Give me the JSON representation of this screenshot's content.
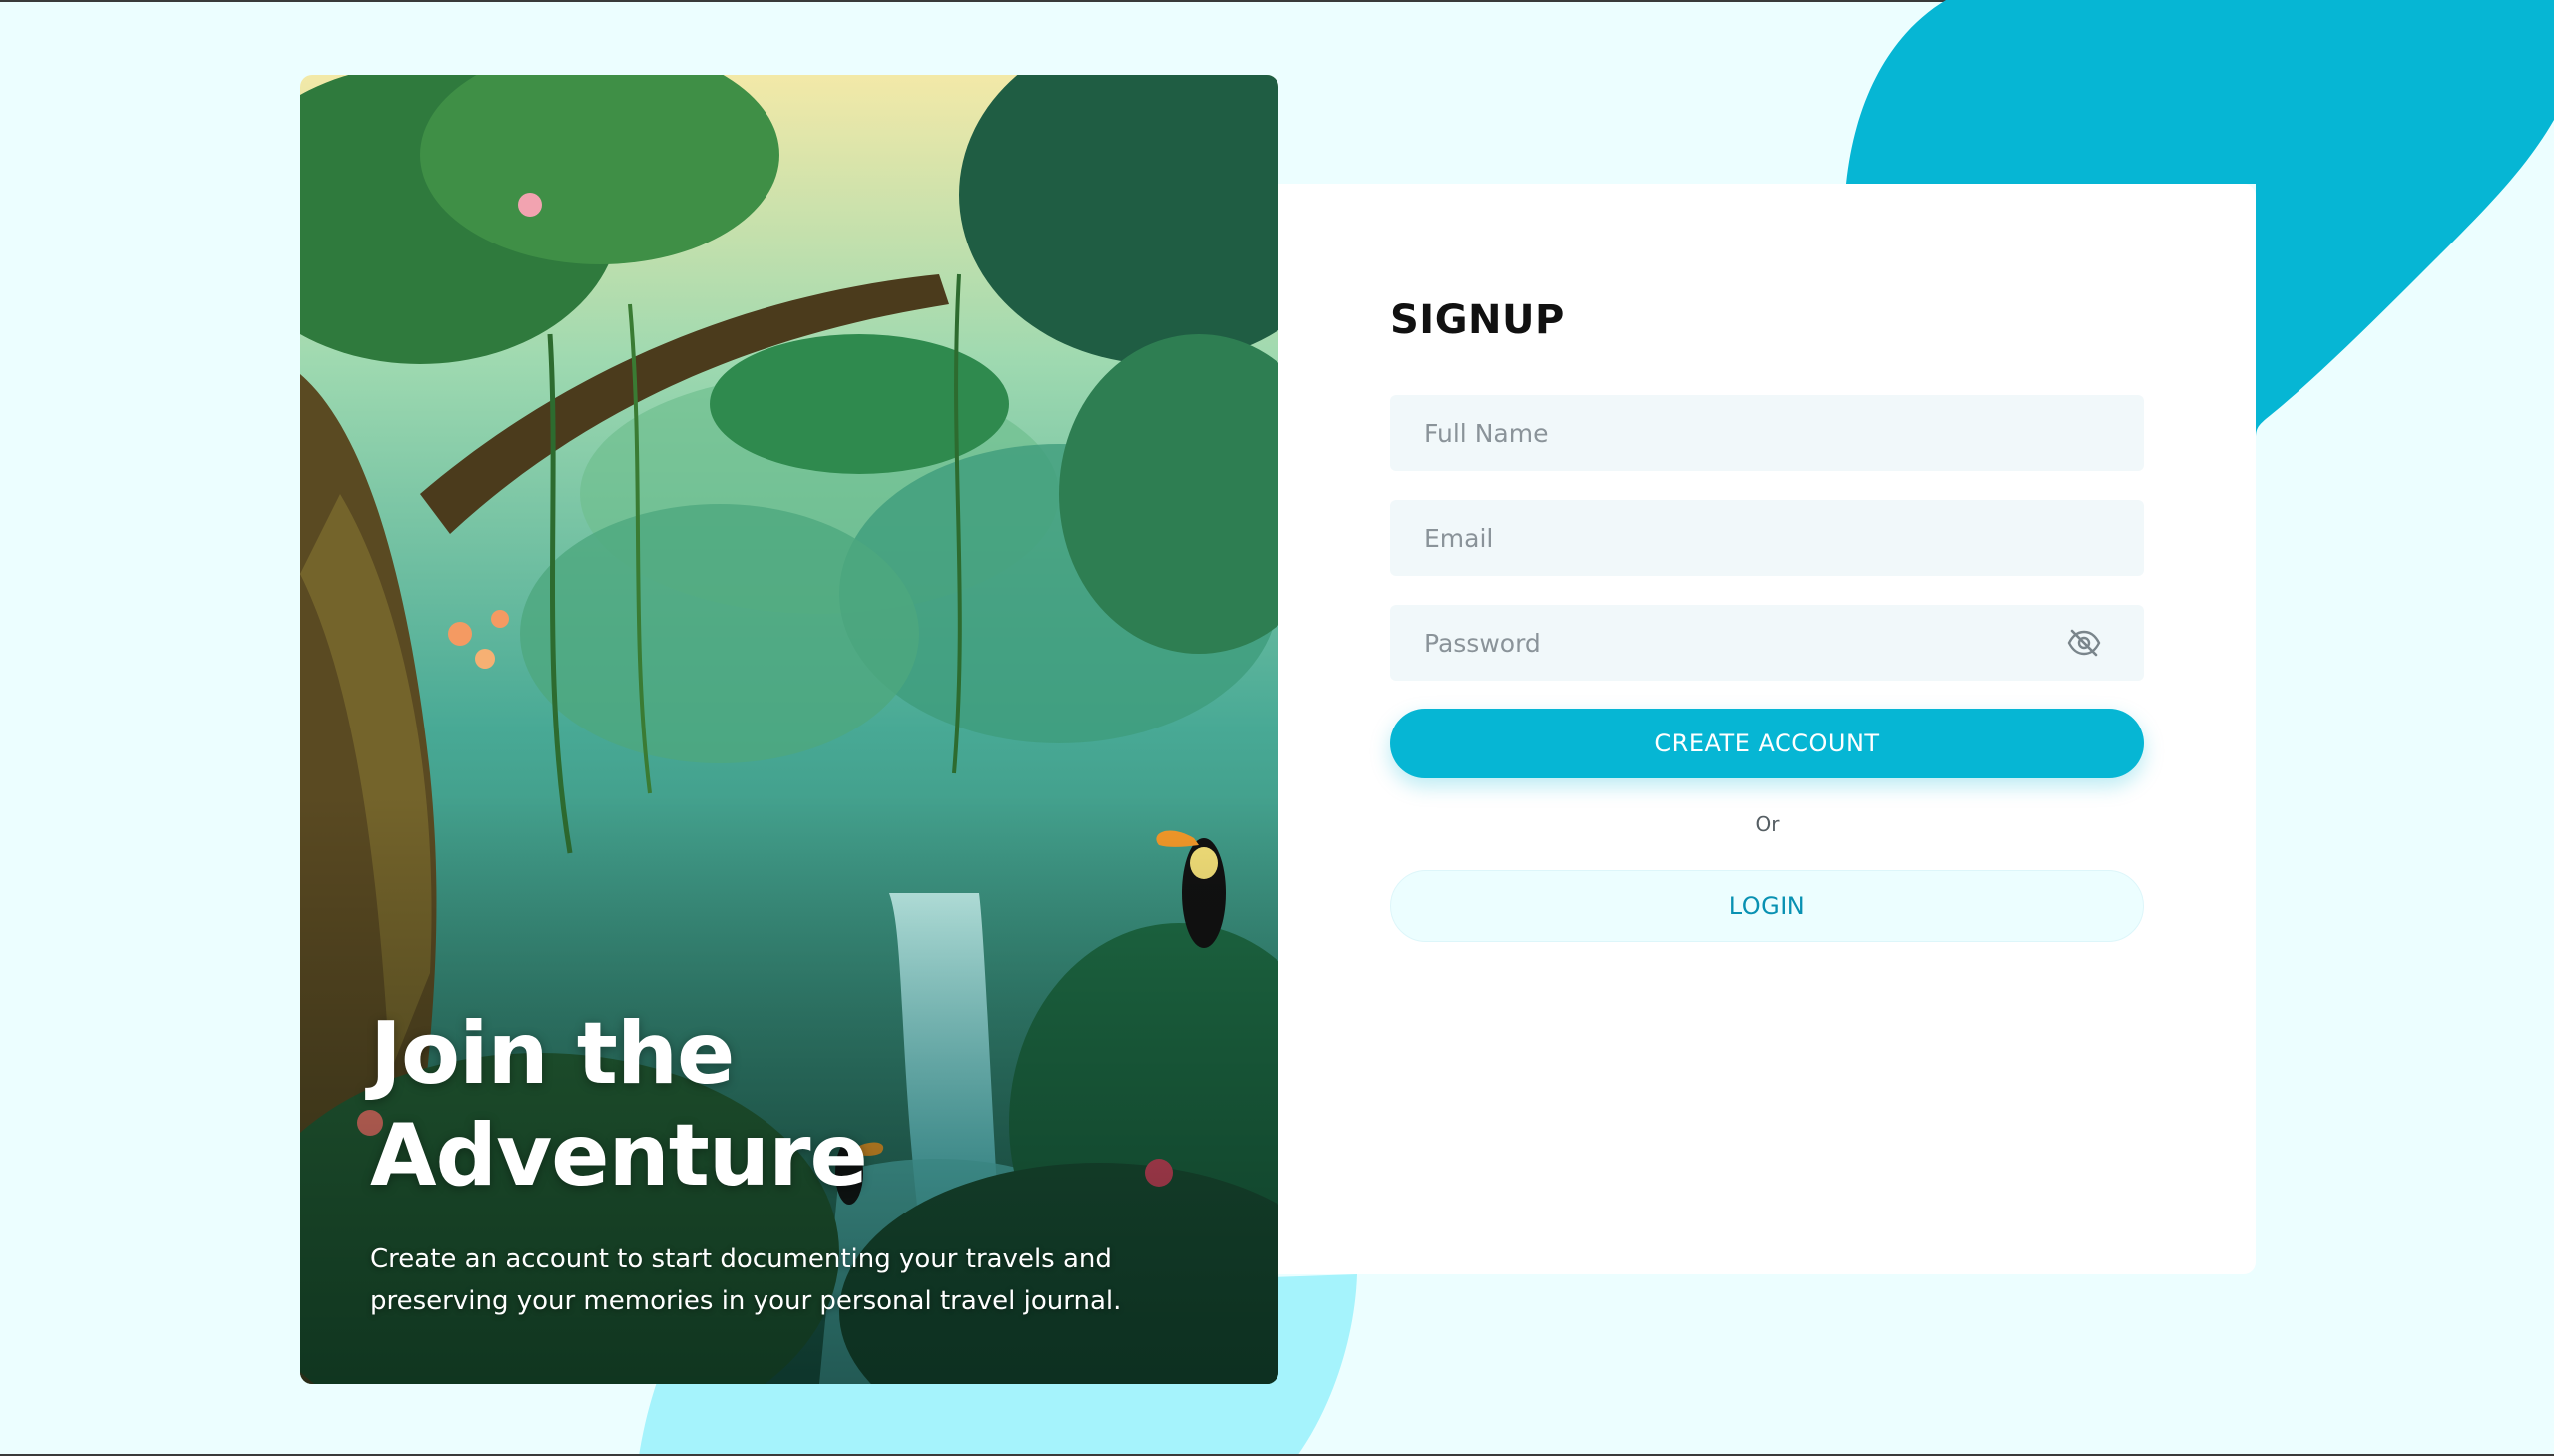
{
  "hero": {
    "title": "Join the\nAdventure",
    "subtitle": "Create an account to start documenting your travels and preserving your memories in your personal travel journal."
  },
  "form": {
    "title": "SIGNUP",
    "full_name_placeholder": "Full Name",
    "email_placeholder": "Email",
    "password_placeholder": "Password",
    "password_toggle_icon": "eye-off-icon",
    "create_account_label": "CREATE ACCOUNT",
    "divider_text": "Or",
    "login_label": "LOGIN"
  },
  "colors": {
    "background": "#ECFEFF",
    "accent": "#06B6D4",
    "accent_light": "#A5F3FC",
    "input_bg": "#F1F8FA",
    "login_text": "#0891B2"
  }
}
